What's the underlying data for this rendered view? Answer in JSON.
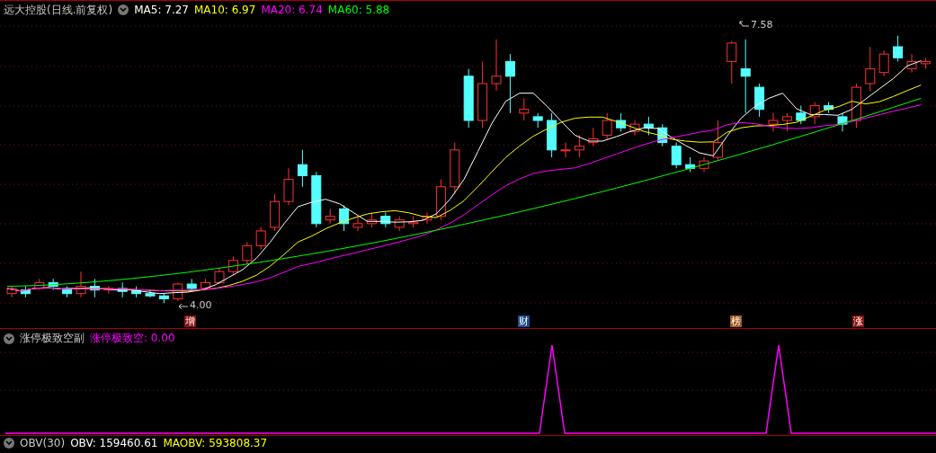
{
  "title": "远大控股(日线.前复权)",
  "indicators": [
    {
      "label": "MA5: 7.27",
      "color": "#ffffff"
    },
    {
      "label": "MA10: 6.97",
      "color": "#ffff00"
    },
    {
      "label": "MA20: 6.74",
      "color": "#ff00ff"
    },
    {
      "label": "MA60: 5.88",
      "color": "#00ff00"
    }
  ],
  "price_notes": [
    {
      "kind": "high",
      "text": "7.58"
    },
    {
      "kind": "low",
      "text": "4.00"
    }
  ],
  "markers": [
    {
      "text": "增",
      "color": "#8c1010"
    },
    {
      "text": "财",
      "color": "#1c4a8c"
    },
    {
      "text": "榜",
      "color": "#a0581c"
    },
    {
      "text": "涨",
      "color": "#8c1010"
    }
  ],
  "sub_panel": {
    "title": "涨停极致空副",
    "reading": "涨停极致空: 0.00"
  },
  "bottom_panel": {
    "title": "OBV(30)",
    "readings": [
      {
        "label": "OBV: 159460.61",
        "color": "#ffffff"
      },
      {
        "label": "MAOBV: 593808.37",
        "color": "#ffff00"
      }
    ]
  }
}
